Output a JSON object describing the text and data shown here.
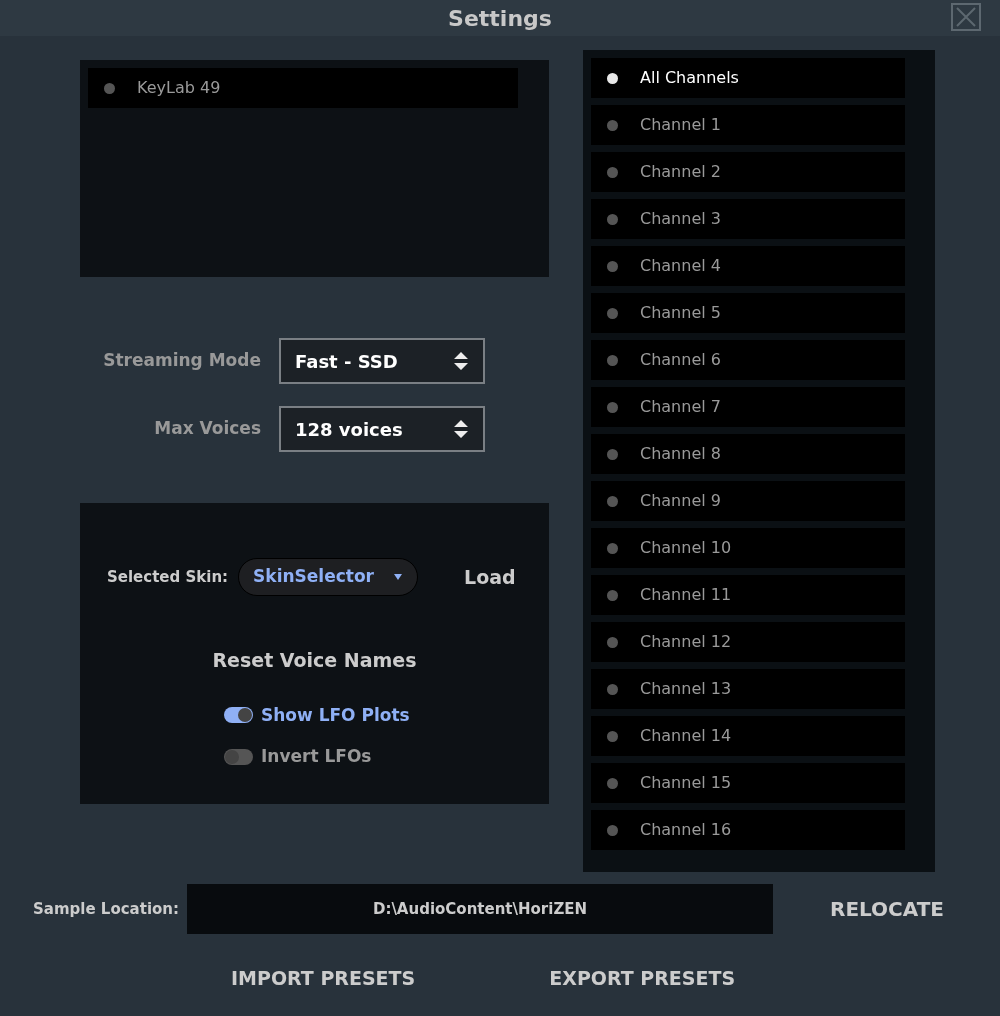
{
  "window": {
    "title": "Settings"
  },
  "midi_devices": [
    {
      "label": "KeyLab 49",
      "selected": false
    }
  ],
  "settings": [
    {
      "label": "Streaming Mode",
      "value": "Fast - SSD"
    },
    {
      "label": "Max Voices",
      "value": "128 voices"
    }
  ],
  "skin": {
    "label": "Selected Skin:",
    "value": "SkinSelector",
    "load": "Load",
    "reset": "Reset Voice Names",
    "toggles": [
      {
        "label": "Show LFO Plots",
        "on": true
      },
      {
        "label": "Invert LFOs",
        "on": false
      }
    ]
  },
  "channels": [
    {
      "label": "All Channels",
      "selected": true
    },
    {
      "label": "Channel 1",
      "selected": false
    },
    {
      "label": "Channel 2",
      "selected": false
    },
    {
      "label": "Channel 3",
      "selected": false
    },
    {
      "label": "Channel 4",
      "selected": false
    },
    {
      "label": "Channel 5",
      "selected": false
    },
    {
      "label": "Channel 6",
      "selected": false
    },
    {
      "label": "Channel 7",
      "selected": false
    },
    {
      "label": "Channel 8",
      "selected": false
    },
    {
      "label": "Channel 9",
      "selected": false
    },
    {
      "label": "Channel 10",
      "selected": false
    },
    {
      "label": "Channel 11",
      "selected": false
    },
    {
      "label": "Channel 12",
      "selected": false
    },
    {
      "label": "Channel 13",
      "selected": false
    },
    {
      "label": "Channel 14",
      "selected": false
    },
    {
      "label": "Channel 15",
      "selected": false
    },
    {
      "label": "Channel 16",
      "selected": false
    }
  ],
  "sample_location": {
    "label": "Sample Location:",
    "value": "D:\\AudioContent\\HoriZEN",
    "button": "RELOCATE"
  },
  "buttons": [
    "IMPORT PRESETS",
    "EXPORT PRESETS"
  ]
}
